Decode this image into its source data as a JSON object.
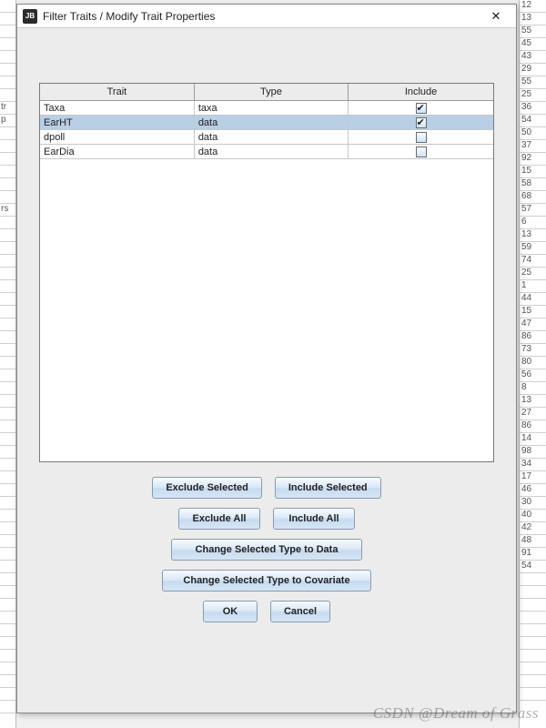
{
  "dialog": {
    "app_icon_text": "JB",
    "title": "Filter Traits / Modify Trait Properties",
    "close_glyph": "✕"
  },
  "table": {
    "headers": {
      "trait": "Trait",
      "type": "Type",
      "include": "Include"
    },
    "rows": [
      {
        "trait": "Taxa",
        "type": "taxa",
        "include": true,
        "selected": false
      },
      {
        "trait": "EarHT",
        "type": "data",
        "include": true,
        "selected": true
      },
      {
        "trait": "dpoll",
        "type": "data",
        "include": false,
        "selected": false
      },
      {
        "trait": "EarDia",
        "type": "data",
        "include": false,
        "selected": false
      }
    ]
  },
  "buttons": {
    "exclude_selected": "Exclude Selected",
    "include_selected": "Include Selected",
    "exclude_all": "Exclude All",
    "include_all": "Include All",
    "change_to_data": "Change Selected Type to Data",
    "change_to_covariate": "Change Selected Type to Covariate",
    "ok": "OK",
    "cancel": "Cancel"
  },
  "watermark": "CSDN @Dream of Grass",
  "bg_left_labels": [
    "",
    "",
    "",
    "",
    "",
    "",
    "",
    "",
    "tr",
    "p",
    "",
    "",
    "",
    "",
    "",
    "",
    "rs",
    "",
    "",
    "",
    "",
    "",
    "",
    "",
    "",
    "",
    "",
    "",
    "",
    "",
    "",
    "",
    "",
    "",
    "",
    "",
    "",
    "",
    "",
    "",
    "",
    "",
    "",
    "",
    "",
    "",
    "",
    "",
    "",
    "",
    "",
    "",
    "",
    "",
    "",
    ""
  ],
  "bg_right_labels": [
    "12",
    "13",
    "55",
    "45",
    "43",
    "29",
    "55",
    "25",
    "36",
    "54",
    "50",
    "37",
    "92",
    "15",
    "58",
    "68",
    "57",
    "6",
    "13",
    "59",
    "74",
    "25",
    "1",
    "44",
    "15",
    "47",
    "86",
    "73",
    "80",
    "56",
    "8",
    "13",
    "27",
    "86",
    "14",
    "98",
    "34",
    "17",
    "46",
    "30",
    "40",
    "42",
    "48",
    "91",
    "54",
    "",
    "",
    "",
    "",
    "",
    "",
    "",
    "",
    "",
    ""
  ]
}
